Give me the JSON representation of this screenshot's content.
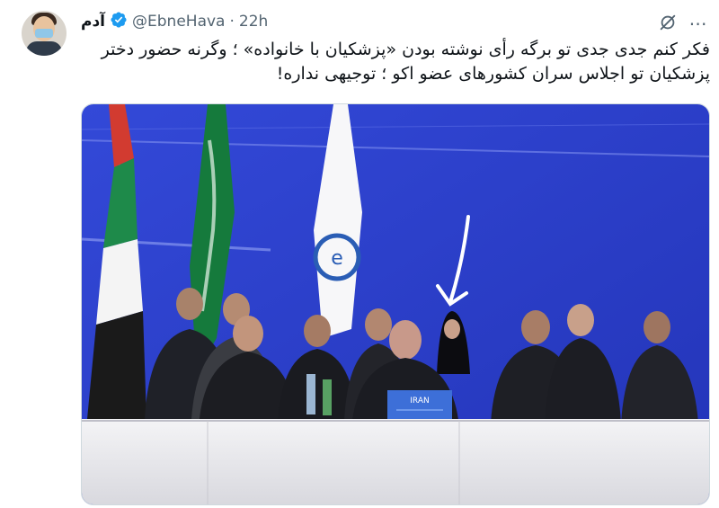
{
  "author": {
    "display_name": "آدم",
    "handle": "@EbneHava",
    "separator": "·",
    "time": "22h",
    "verified": true
  },
  "tweet": {
    "text": "فکر کنم جدی جدی تو برگه رأی نوشته بودن «پزشکیان با خانواده» ؛ وگرنه حضور دختر پزشکیان تو اجلاس سران کشورهای عضو اکو ؛ توجیهی نداره!"
  },
  "media": {
    "type": "photo",
    "nameplate": "IRAN",
    "annotation": "hand-drawn white arrow pointing at a woman in black chador"
  },
  "icons": {
    "avatar": "user-avatar",
    "verified": "verified-badge-icon",
    "grok": "grok-icon",
    "more": "more-options-icon"
  },
  "colors": {
    "verified": "#1d9bf0",
    "secondary_text": "#536471",
    "primary_text": "#0f1419",
    "backdrop": "#2a3fd0"
  }
}
